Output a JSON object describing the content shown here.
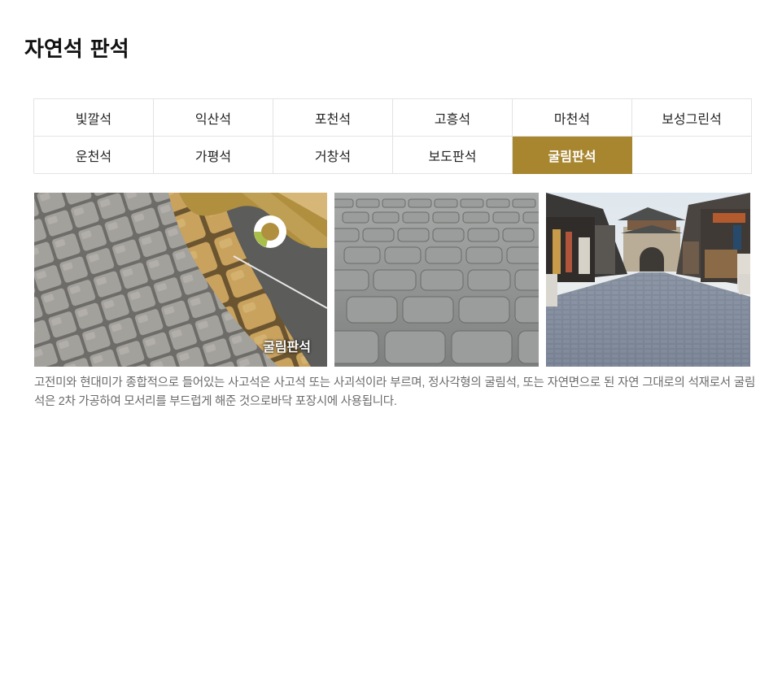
{
  "page": {
    "title": "자연석 판석"
  },
  "tabs": [
    {
      "label": "빛깔석",
      "active": false
    },
    {
      "label": "익산석",
      "active": false
    },
    {
      "label": "포천석",
      "active": false
    },
    {
      "label": "고흥석",
      "active": false
    },
    {
      "label": "마천석",
      "active": false
    },
    {
      "label": "보성그린석",
      "active": false
    },
    {
      "label": "운천석",
      "active": false
    },
    {
      "label": "가평석",
      "active": false
    },
    {
      "label": "거창석",
      "active": false
    },
    {
      "label": "보도판석",
      "active": false
    },
    {
      "label": "굴림판석",
      "active": true
    },
    {
      "label": "",
      "active": false
    }
  ],
  "photos": {
    "photo1_label": "굴림판석"
  },
  "description": "고전미와 현대미가 종합적으로 들어있는 사고석은 사고석 또는 사괴석이라 부르며, 정사각형의 굴림석, 또는 자연면으로 된 자연 그대로의 석재로서 굴림석은 2차 가공하여 모서리를 부드럽게 해준 것으로바닥 포장시에 사용됩니다.",
  "colors": {
    "accent": "#a8862f",
    "border": "#e3e3e3",
    "description_text": "#6b6b6b"
  }
}
